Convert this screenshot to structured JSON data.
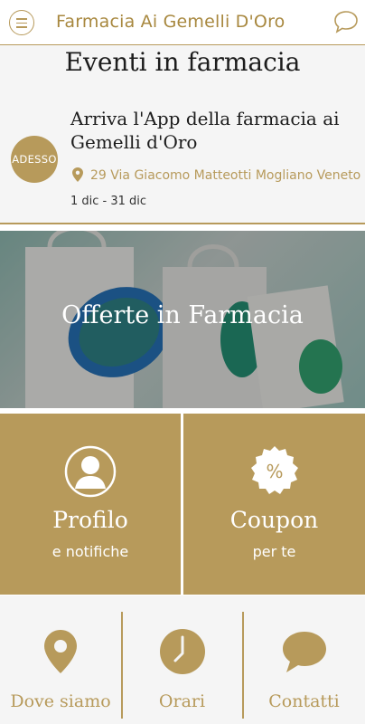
{
  "header": {
    "title": "Farmacia Ai Gemelli D'Oro",
    "menu_icon": "hamburger-menu-icon",
    "chat_icon": "chat-bubble-icon"
  },
  "events": {
    "section_title": "Eventi in farmacia",
    "badge": "ADESSO",
    "event_title": "Arriva l'App della farmacia ai Gemelli d'Oro",
    "location": "29 Via Giacomo Matteotti Mogliano Veneto",
    "dates": "1 dic - 31 dic"
  },
  "banner": {
    "title": "Offerte in Farmacia"
  },
  "tiles": {
    "profile": {
      "label": "Profilo",
      "sub": "e notifiche",
      "icon": "user-avatar-icon"
    },
    "coupon": {
      "label": "Coupon",
      "sub": "per te",
      "icon": "percent-badge-icon"
    }
  },
  "bottom_nav": {
    "where": {
      "label": "Dove siamo",
      "icon": "map-pin-icon"
    },
    "hours": {
      "label": "Orari",
      "icon": "clock-icon"
    },
    "contacts": {
      "label": "Contatti",
      "icon": "chat-bubble-icon"
    }
  },
  "colors": {
    "gold": "#b79a5b",
    "background": "#f5f5f5"
  }
}
